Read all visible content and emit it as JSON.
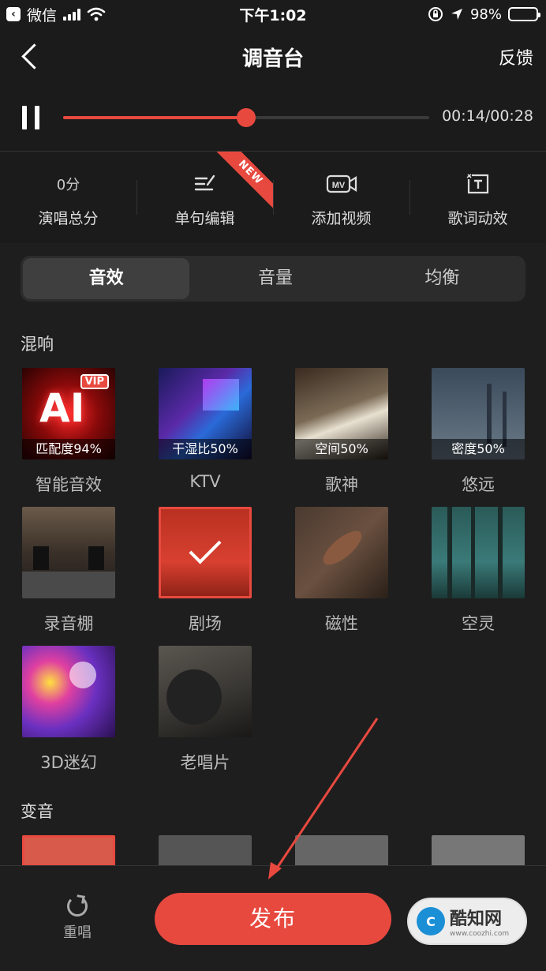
{
  "status_bar": {
    "app": "微信",
    "time": "下午1:02",
    "battery": "98%"
  },
  "header": {
    "title": "调音台",
    "feedback": "反馈"
  },
  "player": {
    "time_readout": "00:14/00:28",
    "progress": 0.5
  },
  "tools": [
    {
      "top": "0分",
      "label": "演唱总分",
      "icon": ""
    },
    {
      "top": "",
      "label": "单句编辑",
      "icon": "edit-lines-icon",
      "badge": "NEW"
    },
    {
      "top": "",
      "label": "添加视频",
      "icon": "mv-camera-icon"
    },
    {
      "top": "",
      "label": "歌词动效",
      "icon": "text-frame-icon"
    }
  ],
  "tabs": [
    {
      "label": "音效",
      "active": true
    },
    {
      "label": "音量",
      "active": false
    },
    {
      "label": "均衡",
      "active": false
    }
  ],
  "sections": {
    "reverb": "混响",
    "voice_change": "变音"
  },
  "effects": [
    {
      "name": "智能音效",
      "caption": "匹配度94%",
      "vip": "VIP",
      "ai": "AI",
      "selected": false
    },
    {
      "name": "KTV",
      "caption": "干湿比50%",
      "selected": false
    },
    {
      "name": "歌神",
      "caption": "空间50%",
      "selected": false
    },
    {
      "name": "悠远",
      "caption": "密度50%",
      "selected": false
    },
    {
      "name": "录音棚",
      "caption": "",
      "selected": false
    },
    {
      "name": "剧场",
      "caption": "",
      "selected": true
    },
    {
      "name": "磁性",
      "caption": "",
      "selected": false
    },
    {
      "name": "空灵",
      "caption": "",
      "selected": false
    },
    {
      "name": "3D迷幻",
      "caption": "",
      "selected": false
    },
    {
      "name": "老唱片",
      "caption": "",
      "selected": false
    }
  ],
  "bottom": {
    "redo": "重唱",
    "publish": "发布"
  },
  "watermark": {
    "text": "酷知网",
    "url": "www.coozhi.com",
    "logo": "C"
  },
  "colors": {
    "accent": "#e8493f",
    "background": "#1e1e1e"
  }
}
